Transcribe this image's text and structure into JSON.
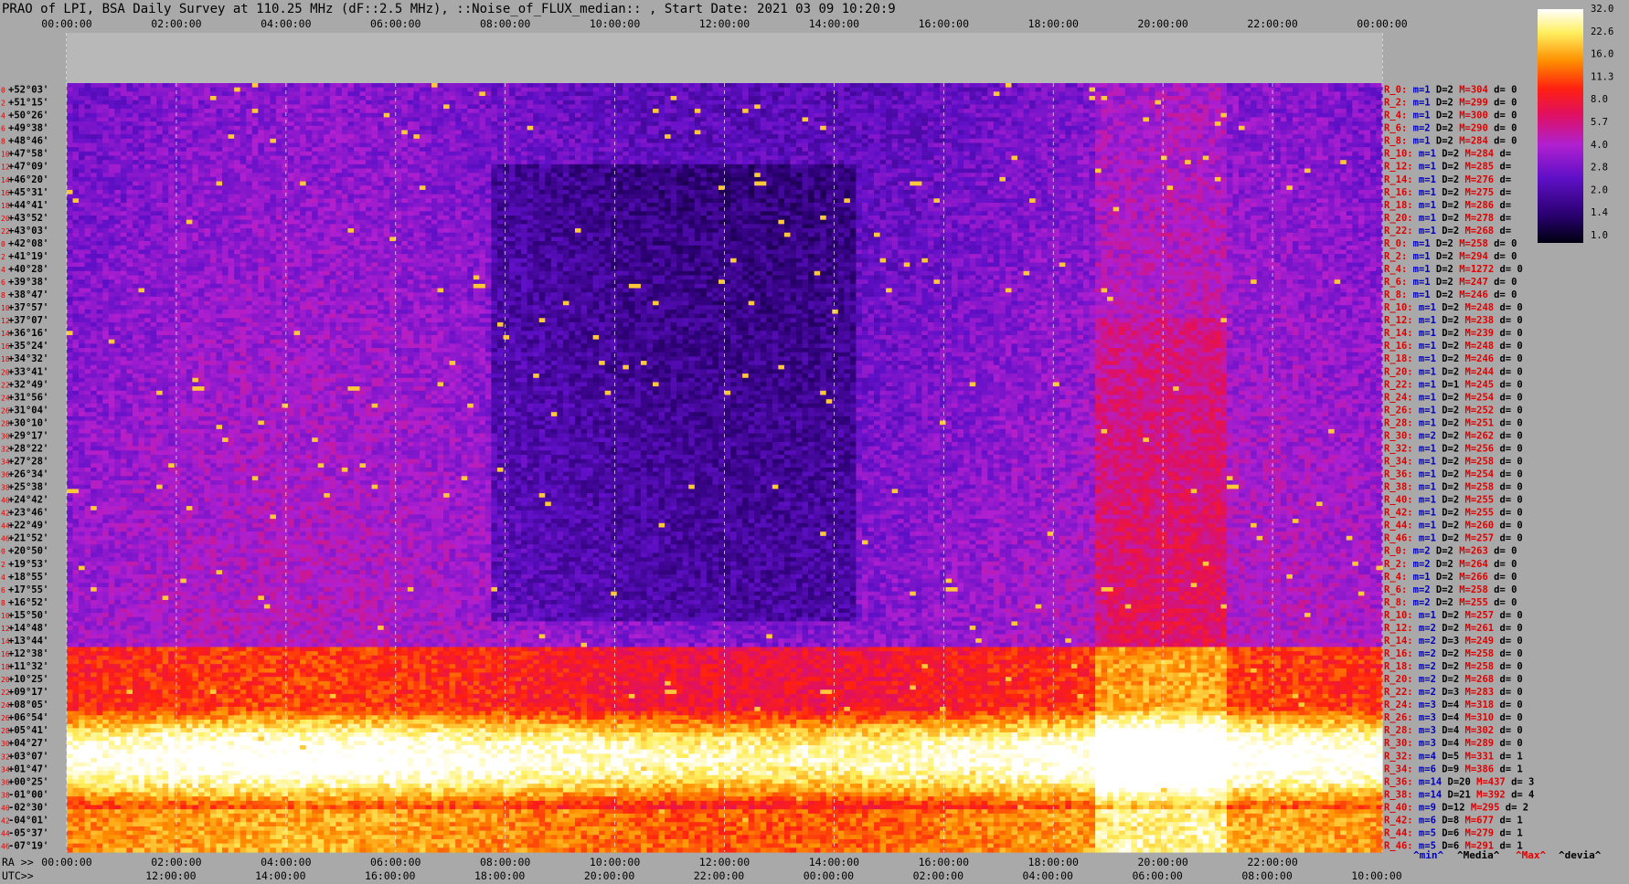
{
  "chart_data": {
    "type": "heatmap",
    "title": "PRAO of LPI, BSA Daily Survey at 110.25 MHz (dF::2.5 MHz), ::Noise_of_FLUX_median:: , Start Date: 2021 03 09 10:20:9",
    "top_axis_ticks": [
      "00:00:00",
      "02:00:00",
      "04:00:00",
      "06:00:00",
      "08:00:00",
      "10:00:00",
      "12:00:00",
      "14:00:00",
      "16:00:00",
      "18:00:00",
      "20:00:00",
      "22:00:00",
      "00:00:00"
    ],
    "ra_prefix": "RA >>",
    "ra_ticks": [
      "00:00:00",
      "02:00:00",
      "04:00:00",
      "06:00:00",
      "08:00:00",
      "10:00:00",
      "12:00:00",
      "14:00:00",
      "16:00:00",
      "18:00:00",
      "20:00:00",
      "22:00:00"
    ],
    "utc_prefix": "UTC>>",
    "utc_ticks": [
      "12:00:00",
      "14:00:00",
      "16:00:00",
      "18:00:00",
      "20:00:00",
      "22:00:00",
      "00:00:00",
      "02:00:00",
      "04:00:00",
      "06:00:00",
      "08:00:00",
      "10:00:00"
    ],
    "declinations": [
      "+52°03'",
      "+51°15'",
      "+50°26'",
      "+49°38'",
      "+48°46'",
      "+47°58'",
      "+47°09'",
      "+46°20'",
      "+45°31'",
      "+44°41'",
      "+43°52'",
      "+43°03'",
      "+42°08'",
      "+41°19'",
      "+40°28'",
      "+39°38'",
      "+38°47'",
      "+37°57'",
      "+37°07'",
      "+36°16'",
      "+35°24'",
      "+34°32'",
      "+33°41'",
      "+32°49'",
      "+31°56'",
      "+31°04'",
      "+30°10'",
      "+29°17'",
      "+28°22'",
      "+27°28'",
      "+26°34'",
      "+25°38'",
      "+24°42'",
      "+23°46'",
      "+22°49'",
      "+21°52'",
      "+20°50'",
      "+19°53'",
      "+18°55'",
      "+17°55'",
      "+16°52'",
      "+15°50'",
      "+14°48'",
      "+13°44'",
      "+12°38'",
      "+11°32'",
      "+10°25'",
      "+09°17'",
      "+08°05'",
      "+06°54'",
      "+05°41'",
      "+04°27'",
      "+03°07'",
      "+01°47'",
      "+00°25'",
      "-01°00'",
      "-02°30'",
      "-04°01'",
      "-05°37'",
      "-07°19'"
    ],
    "row_indices": [
      "0",
      "2",
      "4",
      "6",
      "8",
      "10",
      "12",
      "14",
      "16",
      "18",
      "20",
      "22",
      "0",
      "2",
      "4",
      "6",
      "8",
      "10",
      "12",
      "14",
      "16",
      "18",
      "20",
      "22",
      "24",
      "26",
      "28",
      "30",
      "32",
      "34",
      "36",
      "38",
      "40",
      "42",
      "44",
      "46",
      "0",
      "2",
      "4",
      "6",
      "8",
      "10",
      "12",
      "14",
      "16",
      "18",
      "20",
      "22",
      "24",
      "26",
      "28",
      "30",
      "32",
      "34",
      "36",
      "38",
      "40",
      "42",
      "44",
      "46"
    ],
    "row_stats": [
      {
        "r": "R_0:",
        "m": "m=1",
        "D": "D=2",
        "M": "M=304",
        "d": "d= 0"
      },
      {
        "r": "R_2:",
        "m": "m=1",
        "D": "D=2",
        "M": "M=299",
        "d": "d= 0"
      },
      {
        "r": "R_4:",
        "m": "m=1",
        "D": "D=2",
        "M": "M=300",
        "d": "d= 0"
      },
      {
        "r": "R_6:",
        "m": "m=2",
        "D": "D=2",
        "M": "M=290",
        "d": "d= 0"
      },
      {
        "r": "R_8:",
        "m": "m=1",
        "D": "D=2",
        "M": "M=284",
        "d": "d= 0"
      },
      {
        "r": "R_10:",
        "m": "m=1",
        "D": "D=2",
        "M": "M=284",
        "d": "d="
      },
      {
        "r": "R_12:",
        "m": "m=1",
        "D": "D=2",
        "M": "M=285",
        "d": "d="
      },
      {
        "r": "R_14:",
        "m": "m=1",
        "D": "D=2",
        "M": "M=276",
        "d": "d="
      },
      {
        "r": "R_16:",
        "m": "m=1",
        "D": "D=2",
        "M": "M=275",
        "d": "d="
      },
      {
        "r": "R_18:",
        "m": "m=1",
        "D": "D=2",
        "M": "M=286",
        "d": "d="
      },
      {
        "r": "R_20:",
        "m": "m=1",
        "D": "D=2",
        "M": "M=278",
        "d": "d="
      },
      {
        "r": "R_22:",
        "m": "m=1",
        "D": "D=2",
        "M": "M=268",
        "d": "d="
      },
      {
        "r": "R_0:",
        "m": "m=1",
        "D": "D=2",
        "M": "M=258",
        "d": "d= 0"
      },
      {
        "r": "R_2:",
        "m": "m=1",
        "D": "D=2",
        "M": "M=294",
        "d": "d= 0"
      },
      {
        "r": "R_4:",
        "m": "m=1",
        "D": "D=2",
        "M": "M=1272",
        "d": "d= 0"
      },
      {
        "r": "R_6:",
        "m": "m=1",
        "D": "D=2",
        "M": "M=247",
        "d": "d= 0"
      },
      {
        "r": "R_8:",
        "m": "m=1",
        "D": "D=2",
        "M": "M=246",
        "d": "d= 0"
      },
      {
        "r": "R_10:",
        "m": "m=1",
        "D": "D=2",
        "M": "M=248",
        "d": "d= 0"
      },
      {
        "r": "R_12:",
        "m": "m=1",
        "D": "D=2",
        "M": "M=238",
        "d": "d= 0"
      },
      {
        "r": "R_14:",
        "m": "m=1",
        "D": "D=2",
        "M": "M=239",
        "d": "d= 0"
      },
      {
        "r": "R_16:",
        "m": "m=1",
        "D": "D=2",
        "M": "M=248",
        "d": "d= 0"
      },
      {
        "r": "R_18:",
        "m": "m=1",
        "D": "D=2",
        "M": "M=246",
        "d": "d= 0"
      },
      {
        "r": "R_20:",
        "m": "m=1",
        "D": "D=2",
        "M": "M=244",
        "d": "d= 0"
      },
      {
        "r": "R_22:",
        "m": "m=1",
        "D": "D=1",
        "M": "M=245",
        "d": "d= 0"
      },
      {
        "r": "R_24:",
        "m": "m=1",
        "D": "D=2",
        "M": "M=254",
        "d": "d= 0"
      },
      {
        "r": "R_26:",
        "m": "m=1",
        "D": "D=2",
        "M": "M=252",
        "d": "d= 0"
      },
      {
        "r": "R_28:",
        "m": "m=1",
        "D": "D=2",
        "M": "M=251",
        "d": "d= 0"
      },
      {
        "r": "R_30:",
        "m": "m=2",
        "D": "D=2",
        "M": "M=262",
        "d": "d= 0"
      },
      {
        "r": "R_32:",
        "m": "m=1",
        "D": "D=2",
        "M": "M=256",
        "d": "d= 0"
      },
      {
        "r": "R_34:",
        "m": "m=1",
        "D": "D=2",
        "M": "M=258",
        "d": "d= 0"
      },
      {
        "r": "R_36:",
        "m": "m=1",
        "D": "D=2",
        "M": "M=254",
        "d": "d= 0"
      },
      {
        "r": "R_38:",
        "m": "m=1",
        "D": "D=2",
        "M": "M=258",
        "d": "d= 0"
      },
      {
        "r": "R_40:",
        "m": "m=1",
        "D": "D=2",
        "M": "M=255",
        "d": "d= 0"
      },
      {
        "r": "R_42:",
        "m": "m=1",
        "D": "D=2",
        "M": "M=255",
        "d": "d= 0"
      },
      {
        "r": "R_44:",
        "m": "m=1",
        "D": "D=2",
        "M": "M=260",
        "d": "d= 0"
      },
      {
        "r": "R_46:",
        "m": "m=1",
        "D": "D=2",
        "M": "M=257",
        "d": "d= 0"
      },
      {
        "r": "R_0:",
        "m": "m=2",
        "D": "D=2",
        "M": "M=263",
        "d": "d= 0"
      },
      {
        "r": "R_2:",
        "m": "m=2",
        "D": "D=2",
        "M": "M=264",
        "d": "d= 0"
      },
      {
        "r": "R_4:",
        "m": "m=1",
        "D": "D=2",
        "M": "M=266",
        "d": "d= 0"
      },
      {
        "r": "R_6:",
        "m": "m=2",
        "D": "D=2",
        "M": "M=258",
        "d": "d= 0"
      },
      {
        "r": "R_8:",
        "m": "m=2",
        "D": "D=2",
        "M": "M=255",
        "d": "d= 0"
      },
      {
        "r": "R_10:",
        "m": "m=1",
        "D": "D=2",
        "M": "M=257",
        "d": "d= 0"
      },
      {
        "r": "R_12:",
        "m": "m=2",
        "D": "D=2",
        "M": "M=261",
        "d": "d= 0"
      },
      {
        "r": "R_14:",
        "m": "m=2",
        "D": "D=3",
        "M": "M=249",
        "d": "d= 0"
      },
      {
        "r": "R_16:",
        "m": "m=2",
        "D": "D=2",
        "M": "M=258",
        "d": "d= 0"
      },
      {
        "r": "R_18:",
        "m": "m=2",
        "D": "D=2",
        "M": "M=258",
        "d": "d= 0"
      },
      {
        "r": "R_20:",
        "m": "m=2",
        "D": "D=2",
        "M": "M=268",
        "d": "d= 0"
      },
      {
        "r": "R_22:",
        "m": "m=2",
        "D": "D=3",
        "M": "M=283",
        "d": "d= 0"
      },
      {
        "r": "R_24:",
        "m": "m=3",
        "D": "D=4",
        "M": "M=318",
        "d": "d= 0"
      },
      {
        "r": "R_26:",
        "m": "m=3",
        "D": "D=4",
        "M": "M=310",
        "d": "d= 0"
      },
      {
        "r": "R_28:",
        "m": "m=3",
        "D": "D=4",
        "M": "M=302",
        "d": "d= 0"
      },
      {
        "r": "R_30:",
        "m": "m=3",
        "D": "D=4",
        "M": "M=289",
        "d": "d= 0"
      },
      {
        "r": "R_32:",
        "m": "m=4",
        "D": "D=5",
        "M": "M=331",
        "d": "d= 1"
      },
      {
        "r": "R_34:",
        "m": "m=6",
        "D": "D=9",
        "M": "M=386",
        "d": "d= 1"
      },
      {
        "r": "R_36:",
        "m": "m=14",
        "D": "D=20",
        "M": "M=437",
        "d": "d= 3"
      },
      {
        "r": "R_38:",
        "m": "m=14",
        "D": "D=21",
        "M": "M=392",
        "d": "d= 4"
      },
      {
        "r": "R_40:",
        "m": "m=9",
        "D": "D=12",
        "M": "M=295",
        "d": "d= 2"
      },
      {
        "r": "R_42:",
        "m": "m=6",
        "D": "D=8",
        "M": "M=677",
        "d": "d= 1"
      },
      {
        "r": "R_44:",
        "m": "m=5",
        "D": "D=6",
        "M": "M=279",
        "d": "d= 1"
      },
      {
        "r": "R_46:",
        "m": "m=5",
        "D": "D=6",
        "M": "M=291",
        "d": "d= 1"
      }
    ],
    "stat_legend": [
      "^min^",
      "^Media^",
      "^Max^",
      "^devia^"
    ],
    "colorbar_ticks": [
      "32.0",
      "22.6",
      "16.0",
      "11.3",
      "8.0",
      "5.7",
      "4.0",
      "2.8",
      "2.0",
      "1.4",
      "1.0"
    ],
    "colorscale": [
      "#000010",
      "#1a0050",
      "#3a008c",
      "#5a10c0",
      "#8020d8",
      "#b020d0",
      "#d8208c",
      "#f01030",
      "#ff3a10",
      "#ff8a00",
      "#ffd000",
      "#fff890",
      "#ffffff"
    ],
    "bright_band_declination": "+00°25'"
  }
}
